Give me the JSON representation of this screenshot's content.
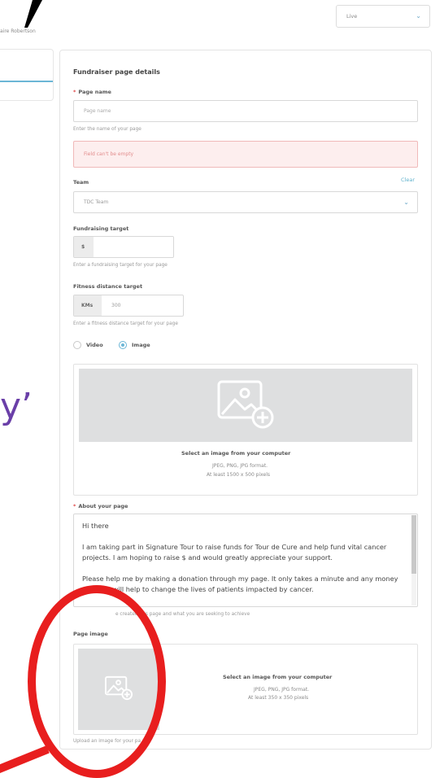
{
  "header": {
    "user_name": "aire Robertson",
    "status": {
      "value": "Live"
    }
  },
  "overlay": {
    "purple_text": "y’"
  },
  "form": {
    "title": "Fundraiser page details",
    "page_name": {
      "label": "Page name",
      "required_mark": "*",
      "placeholder": "Page name",
      "hint": "Enter the name of your page",
      "error": "Field can't be empty"
    },
    "team": {
      "label": "Team",
      "clear": "Clear",
      "value": "TDC Team"
    },
    "fundraising_target": {
      "label": "Fundraising target",
      "prefix": "$",
      "value": "",
      "hint": "Enter a fundraising target for your page"
    },
    "fitness_target": {
      "label": "Fitness distance target",
      "prefix": "KMs",
      "value": "300",
      "hint": "Enter a fitness distance target for your page"
    },
    "media_type": {
      "options": [
        "Video",
        "Image"
      ],
      "selected": "Image"
    },
    "banner_upload": {
      "title": "Select an image from your computer",
      "formats": "JPEG, PNG, JPG format.",
      "size": "At least 1500 x 500 pixels"
    },
    "about": {
      "label": "About your page",
      "required_mark": "*",
      "paragraphs": [
        "Hi there",
        "I am taking part in Signature Tour to raise funds for Tour de Cure and help fund vital cancer projects.  I am hoping to raise $ and would greatly appreciate your support.",
        "Please help me by making a donation through my page.  It only takes a minute and any money you give will help to change the lives of patients impacted by cancer."
      ],
      "hint": "e created this page and what you are seeking to achieve"
    },
    "page_image": {
      "label": "Page image",
      "title": "Select an image from your computer",
      "formats": "JPEG, PNG, JPG format.",
      "size": "At least 350 x 350 pixels",
      "hint": "Upload an image for your pa"
    }
  },
  "colors": {
    "accent": "#6cb6d6",
    "error_bg": "#fdeeee",
    "error_border": "#f0b9b9",
    "required": "#e04848",
    "annotation": "#e81e1e",
    "purple": "#6a3fa8"
  },
  "icons": {
    "status_chevron": "chevron-down-icon",
    "team_chevron": "chevron-down-icon",
    "upload": "image-add-icon"
  }
}
